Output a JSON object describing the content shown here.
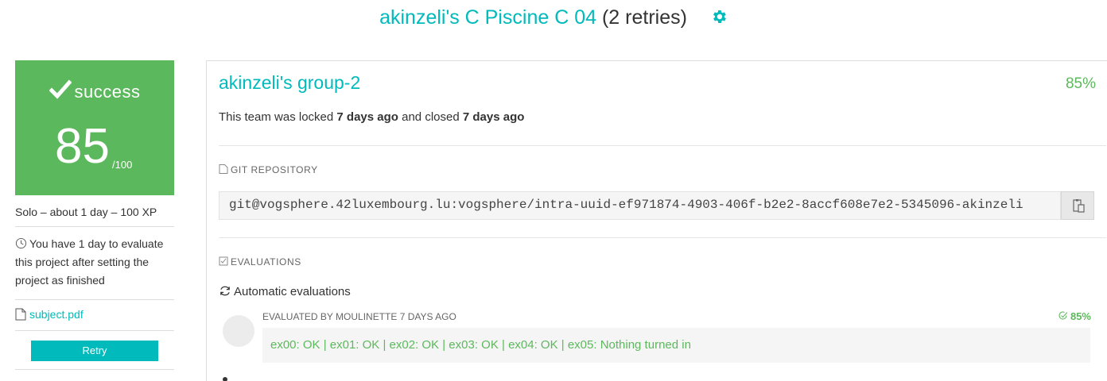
{
  "header": {
    "title_link": "akinzeli's C Piscine C 04",
    "title_retries": "(2 retries)",
    "settings_icon": "gear-icon"
  },
  "sidebar": {
    "status": "success",
    "status_icon": "check-icon",
    "score": "85",
    "score_max": "/100",
    "meta": "Solo – about 1 day – 100 XP",
    "evaluation_notice": "You have 1 day to evaluate this project after setting the project as finished",
    "evaluation_icon": "clock-icon",
    "subject_link": "subject.pdf",
    "subject_icon": "file-icon",
    "retry_button": "Retry"
  },
  "team": {
    "name": "akinzeli's group-2",
    "percent": "85%",
    "status_prefix": "This team was locked",
    "locked_time": "7 days ago",
    "status_middle": "and closed",
    "closed_time": "7 days ago"
  },
  "git": {
    "label": "GIT REPOSITORY",
    "url": "git@vogsphere.42luxembourg.lu:vogsphere/intra-uuid-ef971874-4903-406f-b2e2-8accf608e7e2-5345096-akinzeli",
    "copy_icon": "clipboard-icon"
  },
  "evaluations": {
    "label": "EVALUATIONS",
    "automatic_label": "Automatic evaluations",
    "evaluated_by": "EVALUATED BY MOULINETTE 7 DAYS AGO",
    "percent": "85%",
    "trace": "ex00: OK | ex01: OK | ex02: OK | ex03: OK | ex04: OK | ex05: Nothing turned in"
  },
  "colors": {
    "accent": "#00babc",
    "success": "#5cb85c"
  }
}
